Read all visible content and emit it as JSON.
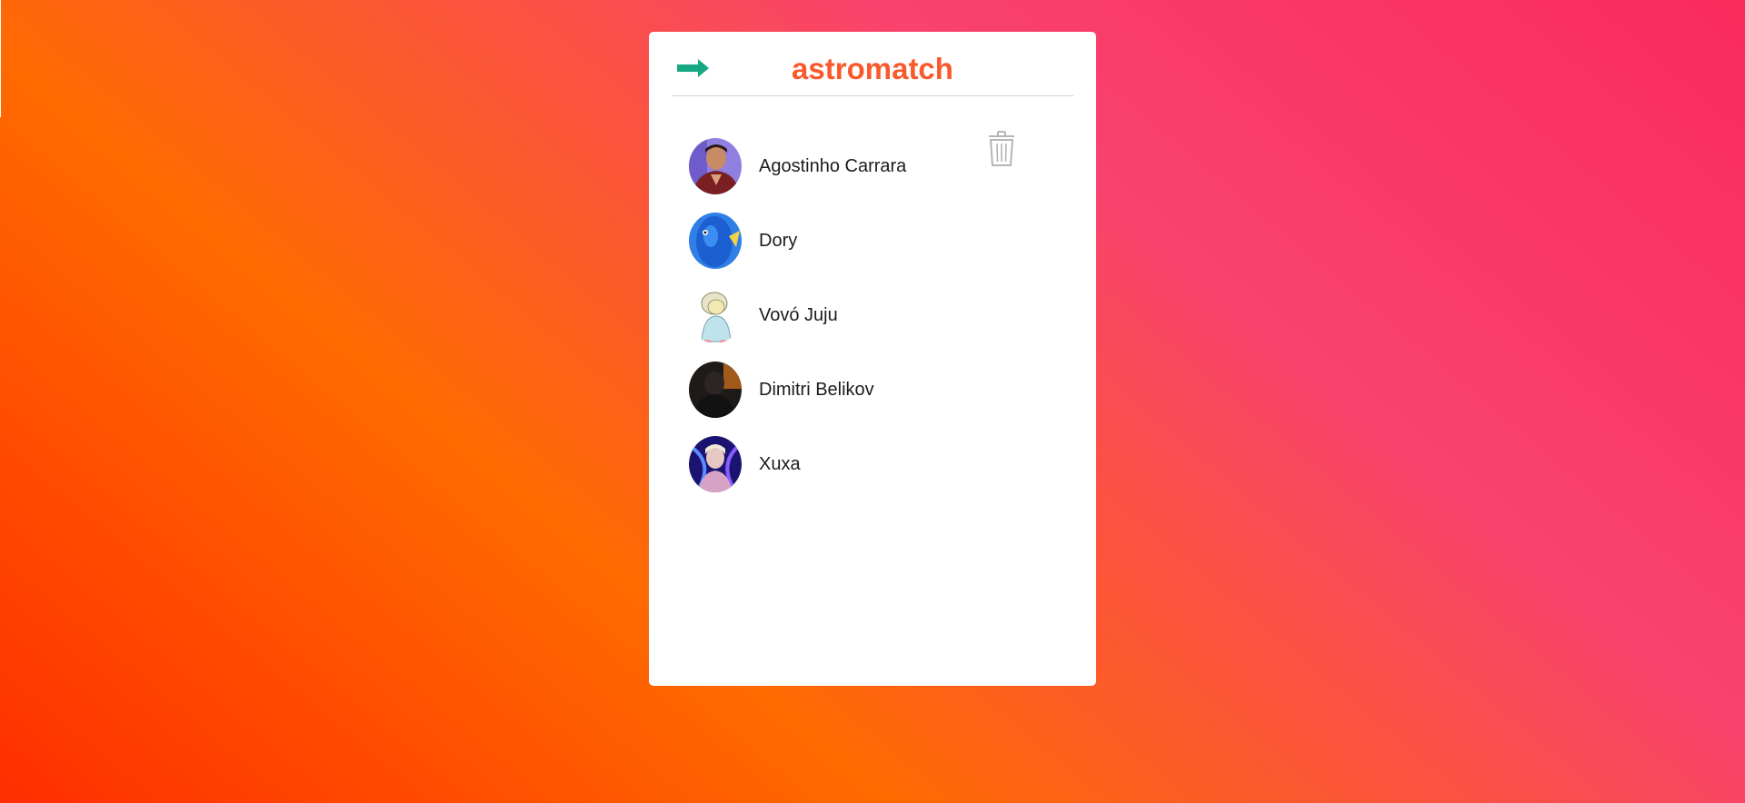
{
  "app": {
    "title": "astromatch"
  },
  "colors": {
    "brand": "#f95a2c",
    "back_arrow": "#16a884",
    "trash": "#b5b5b5"
  },
  "icons": {
    "back": "arrow-right-icon",
    "delete": "trash-icon"
  },
  "matches": [
    {
      "name": "Agostinho Carrara"
    },
    {
      "name": "Dory"
    },
    {
      "name": "Vovó Juju"
    },
    {
      "name": "Dimitri Belikov"
    },
    {
      "name": "Xuxa"
    }
  ]
}
